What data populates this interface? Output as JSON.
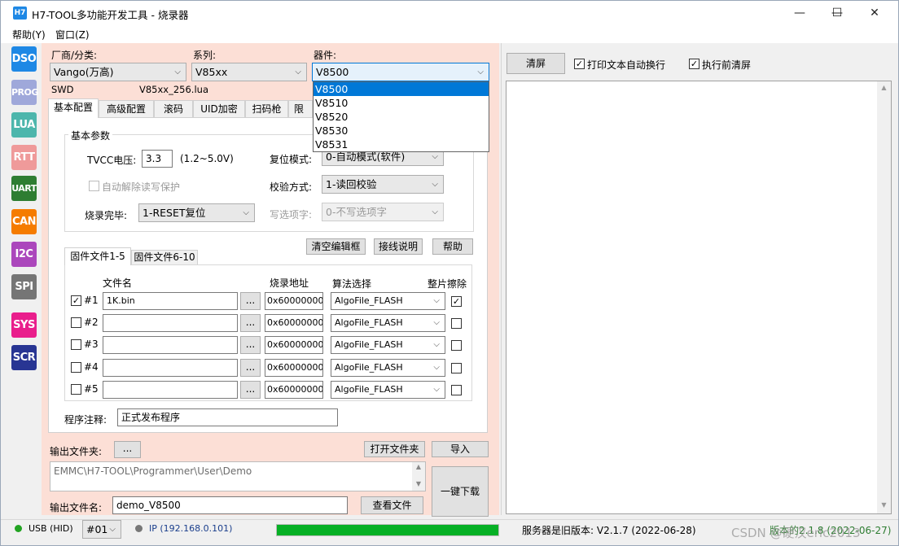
{
  "window": {
    "icon_text": "H7",
    "title": "H7-TOOL多功能开发工具 - 烧录器",
    "minimize": "—",
    "maximize": "☐",
    "close": "✕"
  },
  "menu": [
    "帮助(Y)",
    "窗口(Z)"
  ],
  "sidebar": [
    {
      "label": "DSO",
      "color": "#1e88e5"
    },
    {
      "label": "PROG",
      "color": "#9fa8da"
    },
    {
      "label": "LUA",
      "color": "#4db6ac"
    },
    {
      "label": "RTT",
      "color": "#ef9a9a"
    },
    {
      "label": "UART",
      "color": "#2e7d32"
    },
    {
      "label": "CAN",
      "color": "#f57c00"
    },
    {
      "label": "I2C",
      "color": "#ab47bc"
    },
    {
      "label": "SPI",
      "color": "#757575"
    },
    {
      "label": "SYS",
      "color": "#e91e8c"
    },
    {
      "label": "SCR",
      "color": "#283593"
    }
  ],
  "selectors": {
    "vendor_label": "厂商/分类:",
    "vendor_value": "Vango(万高)",
    "series_label": "系列:",
    "series_value": "V85xx",
    "device_label": "器件:",
    "device_value": "V8500",
    "interface": "SWD",
    "lua_file": "V85xx_256.lua",
    "device_options": [
      "V8500",
      "V8510",
      "V8520",
      "V8530",
      "V8531"
    ]
  },
  "tabs": [
    "基本配置",
    "高级配置",
    "滚码",
    "UID加密",
    "扫码枪",
    "限制"
  ],
  "basic": {
    "group_title": "基本参数",
    "tvcc_label": "TVCC电压:",
    "tvcc_value": "3.3",
    "tvcc_range": "(1.2~5.0V)",
    "auto_unlock": "自动解除读写保护",
    "finish_label": "烧录完毕:",
    "finish_value": "1-RESET复位",
    "reset_label": "复位模式:",
    "reset_value": "0-自动模式(软件)",
    "verify_label": "校验方式:",
    "verify_value": "1-读回校验",
    "option_label": "写选项字:",
    "option_value": "0-不写选项字"
  },
  "actions": {
    "clear_edit": "清空编辑框",
    "wiring": "接线说明",
    "help": "帮助"
  },
  "file_tabs": [
    "固件文件1-5",
    "固件文件6-10"
  ],
  "file_table": {
    "headers": {
      "name": "文件名",
      "addr": "烧录地址",
      "algo": "算法选择",
      "erase": "整片擦除"
    },
    "browse": "...",
    "rows": [
      {
        "id": "#1",
        "checked": true,
        "file": "1K.bin",
        "addr": "0x60000000",
        "algo": "AlgoFile_FLASH",
        "erase": true
      },
      {
        "id": "#2",
        "checked": false,
        "file": "",
        "addr": "0x60000000",
        "algo": "AlgoFile_FLASH",
        "erase": false
      },
      {
        "id": "#3",
        "checked": false,
        "file": "",
        "addr": "0x60000000",
        "algo": "AlgoFile_FLASH",
        "erase": false
      },
      {
        "id": "#4",
        "checked": false,
        "file": "",
        "addr": "0x60000000",
        "algo": "AlgoFile_FLASH",
        "erase": false
      },
      {
        "id": "#5",
        "checked": false,
        "file": "",
        "addr": "0x60000000",
        "algo": "AlgoFile_FLASH",
        "erase": false
      }
    ]
  },
  "notes": {
    "label": "程序注释:",
    "value": "正式发布程序"
  },
  "output": {
    "folder_label": "输出文件夹:",
    "browse": "...",
    "open_folder": "打开文件夹",
    "import": "导入",
    "path": "EMMC\\H7-TOOL\\Programmer\\User\\Demo",
    "name_label": "输出文件名:",
    "name_value": "demo_V8500",
    "view_file": "查看文件",
    "one_key": "一键下载"
  },
  "right": {
    "clear": "清屏",
    "wrap_label": "打印文本自动换行",
    "wrap_checked": true,
    "clear_before_label": "执行前清屏",
    "clear_before_checked": true
  },
  "status": {
    "usb": "USB (HID)",
    "usb_color": "#22a322",
    "device_no": "#01",
    "ip": "IP (192.168.0.101)",
    "ip_color": "#777777",
    "progress": 1.0,
    "server": "服务器是旧版本: V2.1.7 (2022-06-28)",
    "firmware": "版本的2.1.8 (2022-06-27)"
  },
  "watermark": "CSDN @硬汉eric2013"
}
